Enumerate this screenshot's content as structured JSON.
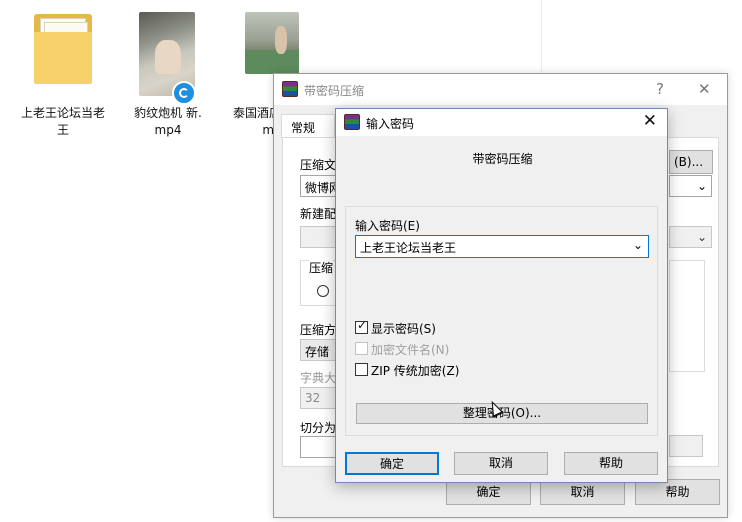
{
  "desktop": {
    "icons": [
      {
        "label_line1": "上老王论坛当老",
        "label_line2": "王",
        "icon": "folder-icon"
      },
      {
        "label_line1": "豹纹炮机 新.",
        "label_line2": "mp4",
        "icon": "video-file-icon"
      },
      {
        "label_line1": "泰国酒店",
        "label_line2": "mp",
        "icon": "video-file-icon"
      }
    ]
  },
  "back_window": {
    "title": "带密码压缩",
    "help_glyph": "?",
    "close_glyph": "✕",
    "tab_general": "常规",
    "archive_name_label": "压缩文",
    "archive_name_value": "微博网",
    "browse_button": "(B)...",
    "profile_label": "新建配",
    "format_group_label": "压缩",
    "method_label": "压缩方",
    "method_value": "存储",
    "dict_label": "字典大",
    "dict_value": "32",
    "split_label": "切分为",
    "ok_button": "确定",
    "cancel_button": "取消",
    "help_button": "帮助"
  },
  "dialog": {
    "title": "输入密码",
    "close_glyph": "✕",
    "heading": "带密码压缩",
    "password_label": "输入密码(E)",
    "password_value": "上老王论坛当老王",
    "show_password_label": "显示密码(S)",
    "show_password_checked": true,
    "encrypt_names_label": "加密文件名(N)",
    "encrypt_names_enabled": false,
    "zip_legacy_label": "ZIP 传统加密(Z)",
    "zip_legacy_checked": false,
    "organize_button": "整理密码(O)...",
    "ok_button": "确定",
    "cancel_button": "取消",
    "help_button": "帮助"
  }
}
